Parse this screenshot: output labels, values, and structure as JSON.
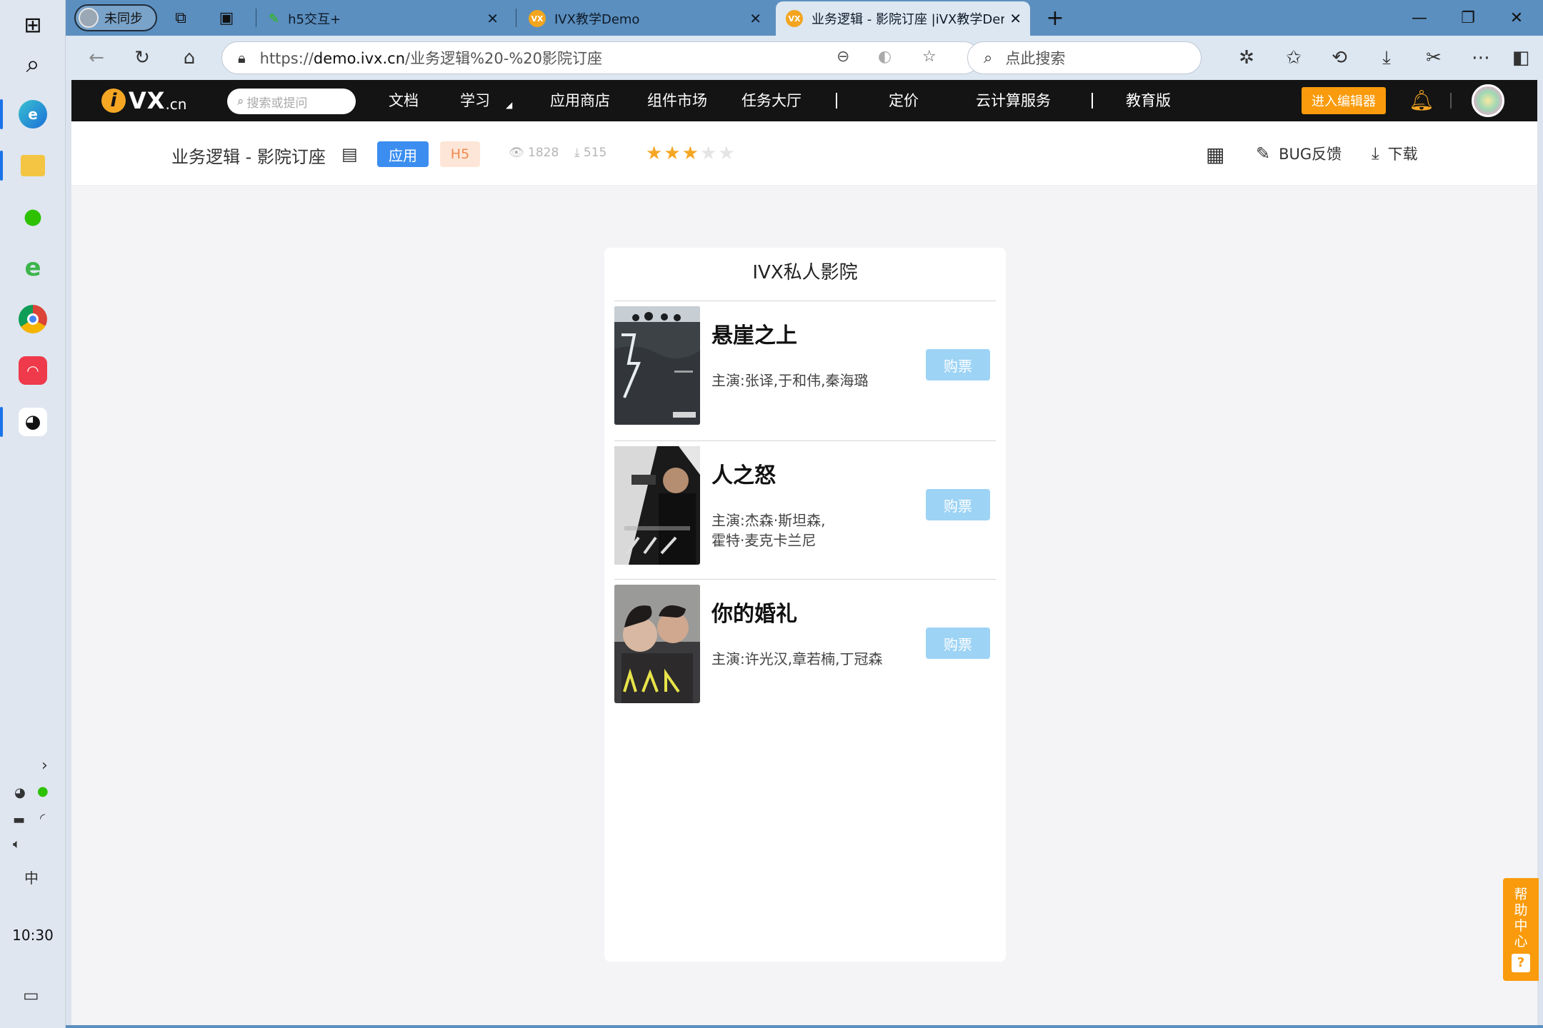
{
  "taskbar": {
    "clock": "10:30",
    "ime": "中",
    "apps": [
      {
        "name": "start",
        "glyph": "⊞"
      },
      {
        "name": "search",
        "glyph": "⌕"
      },
      {
        "name": "edge",
        "glyph": "e"
      },
      {
        "name": "file-explorer",
        "glyph": "▭"
      },
      {
        "name": "wechat",
        "glyph": "◉"
      },
      {
        "name": "ie",
        "glyph": "e"
      },
      {
        "name": "chrome",
        "glyph": "◎"
      },
      {
        "name": "app-red",
        "glyph": "◠"
      },
      {
        "name": "qq",
        "glyph": "◕"
      }
    ]
  },
  "browser": {
    "profile_label": "未同步",
    "tabs": [
      {
        "title": "h5交互+"
      },
      {
        "title": "IVX教学Demo"
      },
      {
        "title": "业务逻辑 - 影院订座 |iVX教学Dem"
      }
    ],
    "new_tab": "+",
    "url_prefix": "https://",
    "url_host": "demo.ivx.cn",
    "url_path": "/业务逻辑%20-%20影院订座",
    "search_placeholder": "点此搜索"
  },
  "site_nav": {
    "logo_i": "i",
    "logo_vx": "VX",
    "logo_cn": ".cn",
    "search_placeholder": "搜索或提问",
    "items": [
      "文档",
      "学习",
      "应用商店",
      "组件市场",
      "任务大厅",
      "定价",
      "云计算服务",
      "教育版"
    ],
    "divider": "|",
    "enter_button": "进入编辑器"
  },
  "app_bar": {
    "title": "业务逻辑 - 影院订座",
    "tag_app": "应用",
    "tag_h5": "H5",
    "views": "1828",
    "downloads": "515",
    "rating": 3,
    "rating_max": 5,
    "bug_label": "BUG反馈",
    "download_label": "下载"
  },
  "phone": {
    "title": "IVX私人影院",
    "buy_label": "购票",
    "movies": [
      {
        "name": "悬崖之上",
        "cast_line1": "主演:张译,于和伟,秦海璐",
        "cast_line2": ""
      },
      {
        "name": "人之怒",
        "cast_line1": "主演:杰森·斯坦森,",
        "cast_line2": "霍特·麦克卡兰尼"
      },
      {
        "name": "你的婚礼",
        "cast_line1": "主演:许光汉,章若楠,丁冠森",
        "cast_line2": ""
      }
    ]
  },
  "help": {
    "chars": [
      "帮",
      "助",
      "中",
      "心"
    ],
    "icon": "?"
  },
  "colors": {
    "accent_orange": "#f99b0c",
    "brand_blue": "#3b8ef0",
    "buy_button": "#9dd3f5",
    "tab_strip": "#5b8fbf"
  }
}
